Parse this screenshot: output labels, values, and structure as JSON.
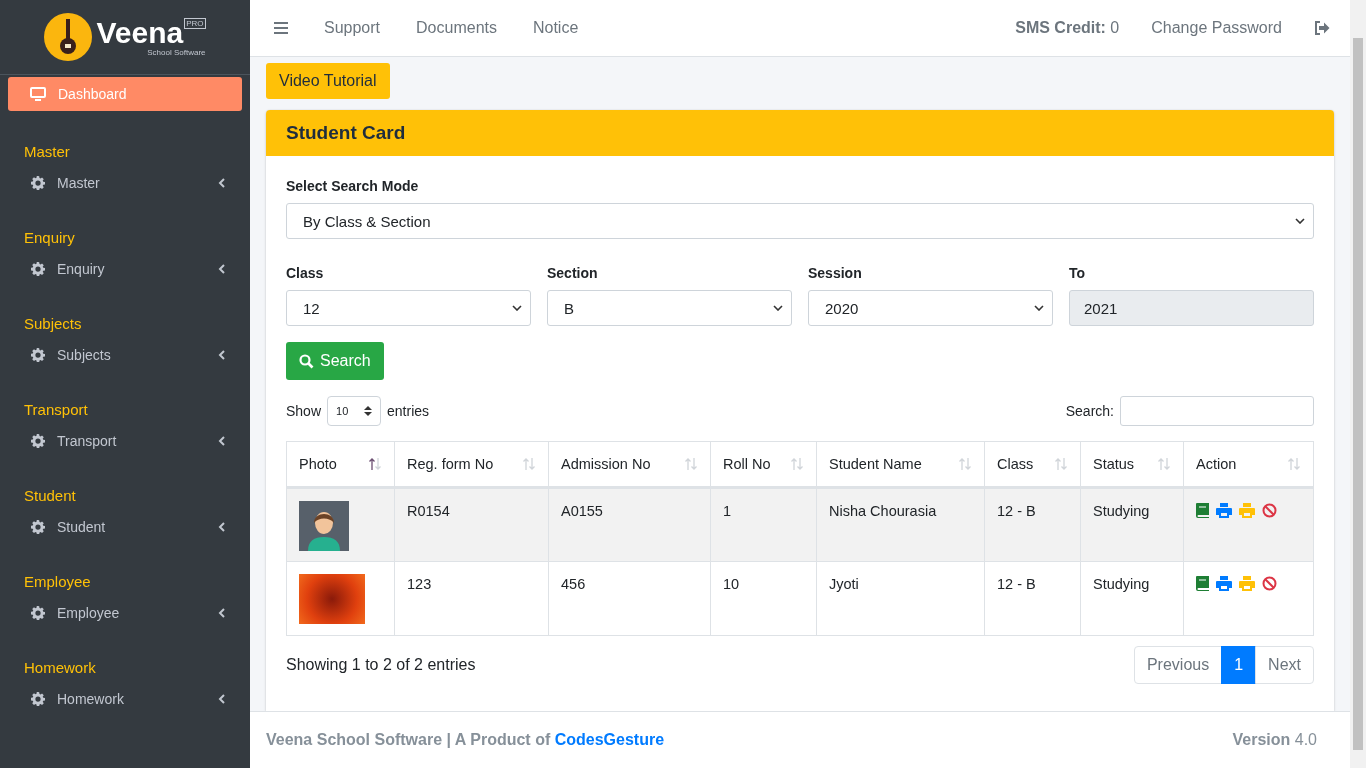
{
  "sidebar": {
    "logo": {
      "name": "Veena",
      "tagline": "School Software",
      "badge": "PRO"
    },
    "dashboard": {
      "label": "Dashboard",
      "selected": true
    },
    "sections": [
      {
        "heading": "Master",
        "item": {
          "label": "Master",
          "expanded": false
        }
      },
      {
        "heading": "Enquiry",
        "item": {
          "label": "Enquiry",
          "expanded": false
        }
      },
      {
        "heading": "Subjects",
        "item": {
          "label": "Subjects",
          "expanded": false
        }
      },
      {
        "heading": "Transport",
        "item": {
          "label": "Transport",
          "expanded": false
        }
      },
      {
        "heading": "Student",
        "item": {
          "label": "Student",
          "expanded": false
        }
      },
      {
        "heading": "Employee",
        "item": {
          "label": "Employee",
          "expanded": false
        }
      },
      {
        "heading": "Homework",
        "item": {
          "label": "Homework",
          "expanded": false
        }
      }
    ]
  },
  "topbar": {
    "links": [
      "Support",
      "Documents",
      "Notice"
    ],
    "sms_credit": "**SMS Credit:** 0",
    "change_password": "Change Password"
  },
  "video_tutorial": "Video Tutorial",
  "card": {
    "title": "Student Card",
    "search_mode": {
      "label": "Select Search Mode",
      "value": "By Class & Section"
    },
    "fields": [
      {
        "label": "Class",
        "value": "12",
        "kind": "select"
      },
      {
        "label": "Section",
        "value": "B",
        "kind": "select"
      },
      {
        "label": "Session",
        "value": "2020",
        "kind": "select"
      },
      {
        "label": "To",
        "value": "2021",
        "kind": "readonly"
      }
    ],
    "search_button": "Search",
    "length": {
      "show": "Show",
      "value": "10",
      "entries": "entries"
    },
    "filter": {
      "label": "Search:"
    },
    "table": {
      "columns": [
        {
          "label": "Photo",
          "sorted": true
        },
        {
          "label": "Reg. form No",
          "sorted": false
        },
        {
          "label": "Admission No",
          "sorted": false
        },
        {
          "label": "Roll No",
          "sorted": false
        },
        {
          "label": "Student Name",
          "sorted": false
        },
        {
          "label": "Class",
          "sorted": false
        },
        {
          "label": "Status",
          "sorted": false
        },
        {
          "label": "Action",
          "sorted": false
        }
      ],
      "rows": [
        {
          "kind": "avatar",
          "reg_form_no": "R0154",
          "admission_no": "A0155",
          "roll_no": "1",
          "student_name": "Nisha Chourasia",
          "class": "12 - B",
          "status": "Studying"
        },
        {
          "kind": "photo",
          "reg_form_no": "123",
          "admission_no": "456",
          "roll_no": "10",
          "student_name": "Jyoti",
          "class": "12 - B",
          "status": "Studying"
        }
      ]
    },
    "info": "Showing 1 to 2 of 2 entries",
    "pagination": [
      {
        "label": "Previous",
        "selected": false
      },
      {
        "label": "1",
        "selected": true
      },
      {
        "label": "Next",
        "selected": false
      }
    ]
  },
  "footer": {
    "text": "Veena School Software | A Product of",
    "link": "CodesGesture",
    "version": "**Version** 4.0"
  }
}
